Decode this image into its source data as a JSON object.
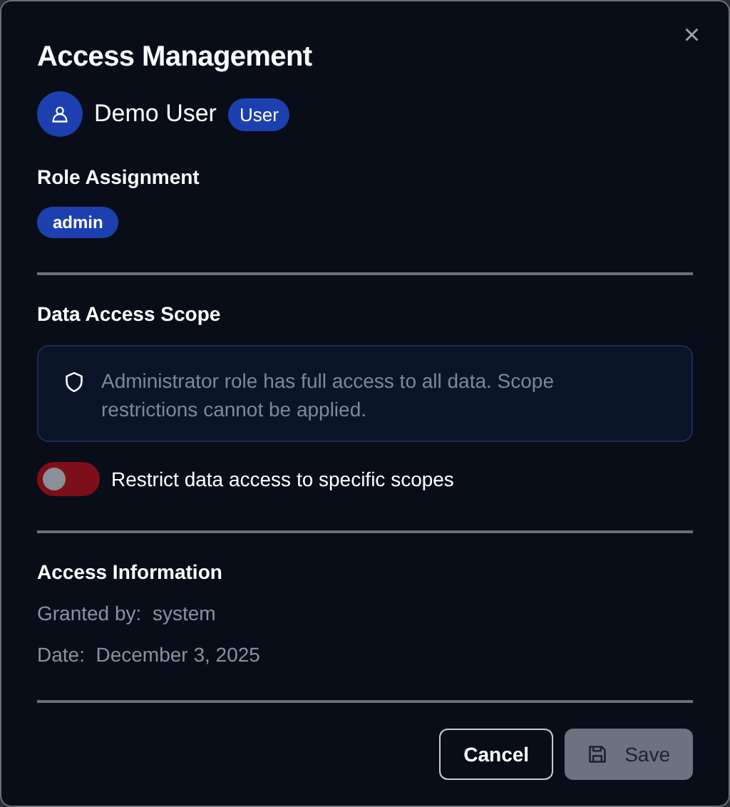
{
  "dialog": {
    "title": "Access Management",
    "close_label": "×"
  },
  "user": {
    "name": "Demo User",
    "badge": "User"
  },
  "role_assignment": {
    "heading": "Role Assignment",
    "roles": [
      "admin"
    ]
  },
  "data_access_scope": {
    "heading": "Data Access Scope",
    "notice": "Administrator role has full access to all data. Scope restrictions cannot be applied.",
    "toggle": {
      "label": "Restrict data access to specific scopes",
      "on": false,
      "disabled": true
    }
  },
  "access_information": {
    "heading": "Access Information",
    "fields": [
      {
        "label": "Granted by:",
        "value": "system"
      },
      {
        "label": "Date:",
        "value": "December 3, 2025"
      }
    ]
  },
  "buttons": [
    {
      "label": "Cancel",
      "kind": "secondary",
      "disabled": false
    },
    {
      "label": "Save",
      "kind": "primary",
      "disabled": true
    }
  ]
}
